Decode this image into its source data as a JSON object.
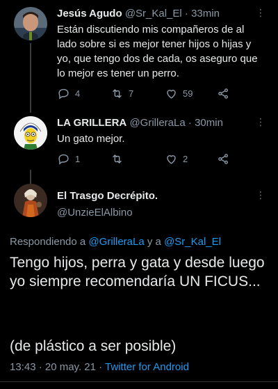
{
  "tweets": [
    {
      "name": "Jesús Agudo",
      "handle": "@Sr_Kal_El",
      "time": "33min",
      "text": "Están discutiendo mis compañeros de al lado sobre si es mejor tener hijos o hijas y yo, que tengo dos de cada, os aseguro que lo mejor es tener un perro.",
      "replies": "4",
      "retweets": "7",
      "likes": "59"
    },
    {
      "name": "LA GRILLERA",
      "handle": "@GrilleraLa",
      "time": "30min",
      "text": "Un gato mejor.",
      "replies": "1",
      "retweets": "",
      "likes": "2",
      "avatar_text": "LA GRILLERA"
    }
  ],
  "main_tweet": {
    "name": "El Trasgo Decrépito.",
    "handle": "@UnzieElAlbino",
    "reply_prefix": "Respondiendo a ",
    "mention1": "@GrilleraLa",
    "reply_mid": " y a ",
    "mention2": "@Sr_Kal_El",
    "text": "Tengo hijos, perra y gata y desde luego yo siempre recomendaría UN FICUS...",
    "text2": "(de plástico a ser posible)",
    "timestamp": "13:43 · 20 may. 21 · ",
    "client": "Twitter for Android"
  },
  "separator": "·",
  "more_glyph": "⋮",
  "colors": {
    "accent": "#1d9bf0",
    "muted": "#8b98a5",
    "background": "#000000"
  }
}
